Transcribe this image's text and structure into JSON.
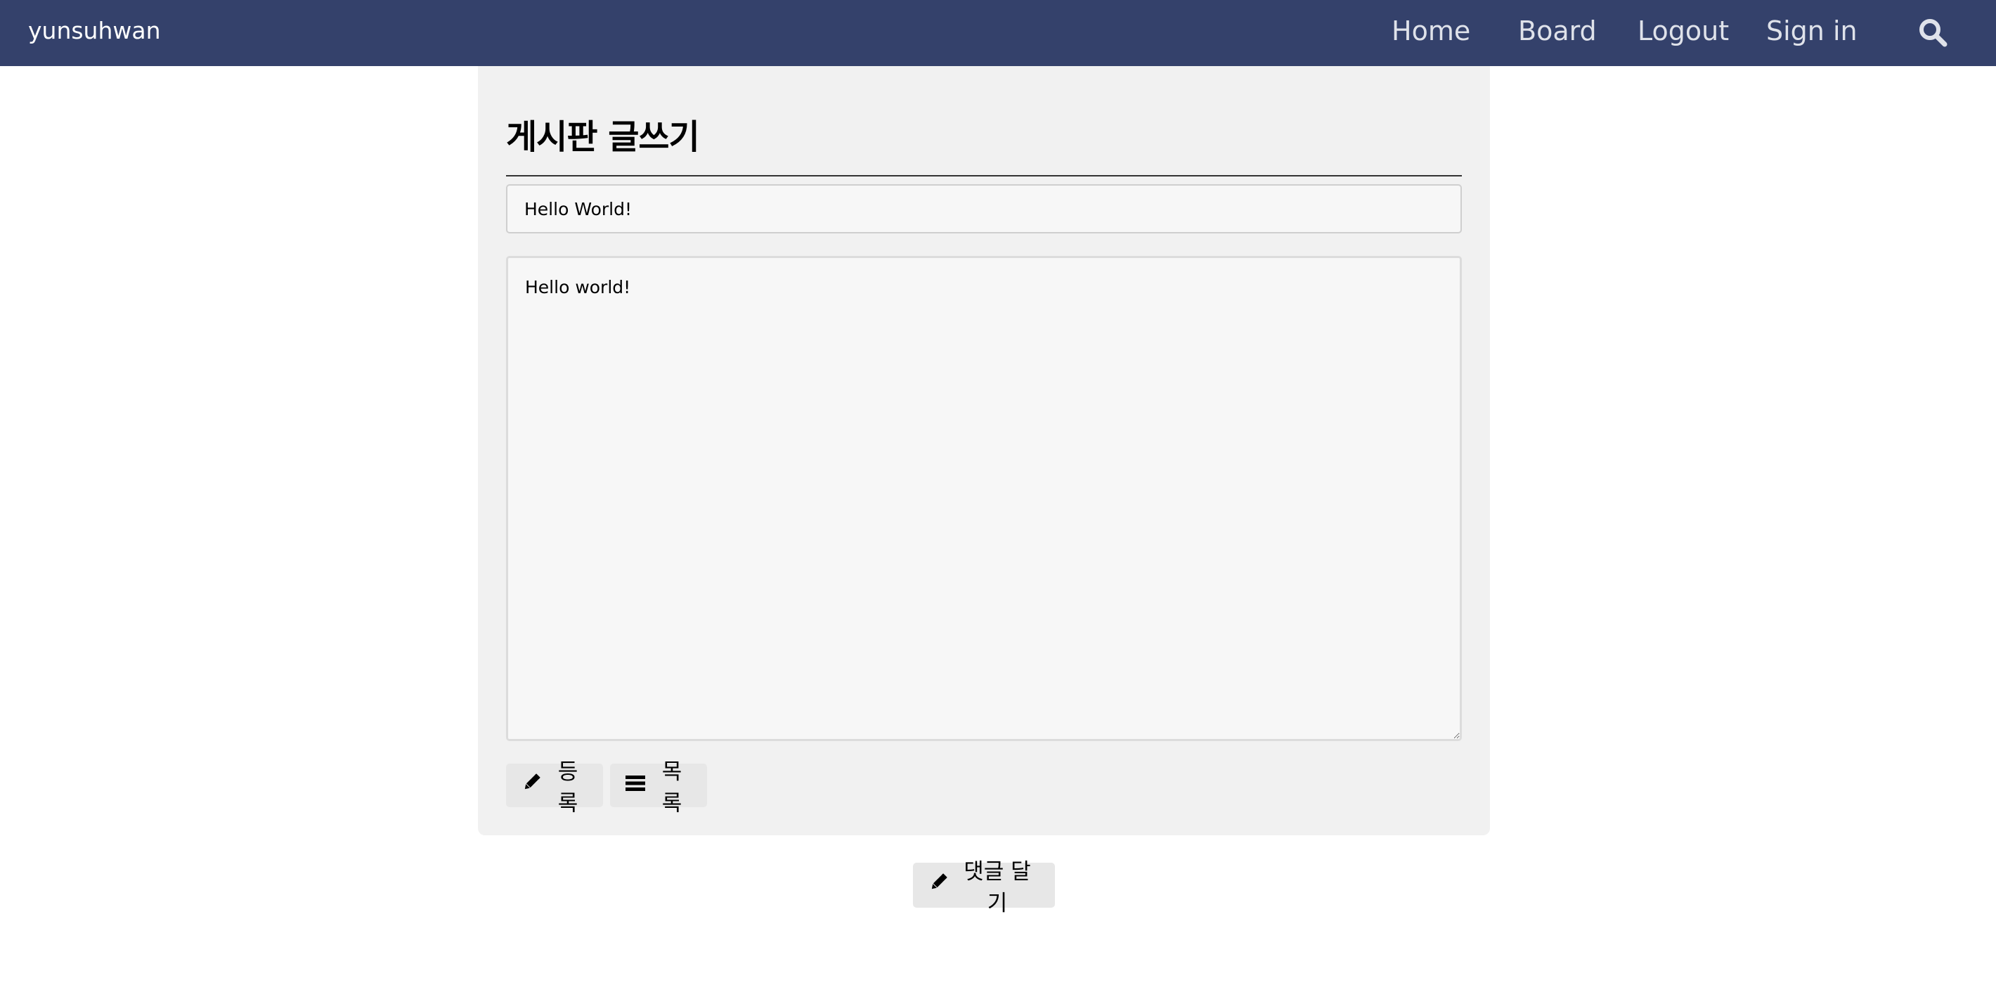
{
  "navbar": {
    "brand": "yunsuhwan",
    "links": [
      {
        "label": "Home"
      },
      {
        "label": "Board"
      },
      {
        "label": "Logout"
      },
      {
        "label": "Sign in"
      }
    ],
    "search_icon": "search-icon",
    "background": "#34416b"
  },
  "board_write": {
    "title": "게시판 글쓰기",
    "title_field_value": "Hello World!",
    "content_value": "Hello world!",
    "buttons": {
      "register_label": "등록",
      "register_icon": "pencil-icon",
      "list_label": "목록",
      "list_icon": "list-icon"
    }
  },
  "comment": {
    "button_label": "댓글 달기",
    "button_icon": "pencil-icon"
  }
}
